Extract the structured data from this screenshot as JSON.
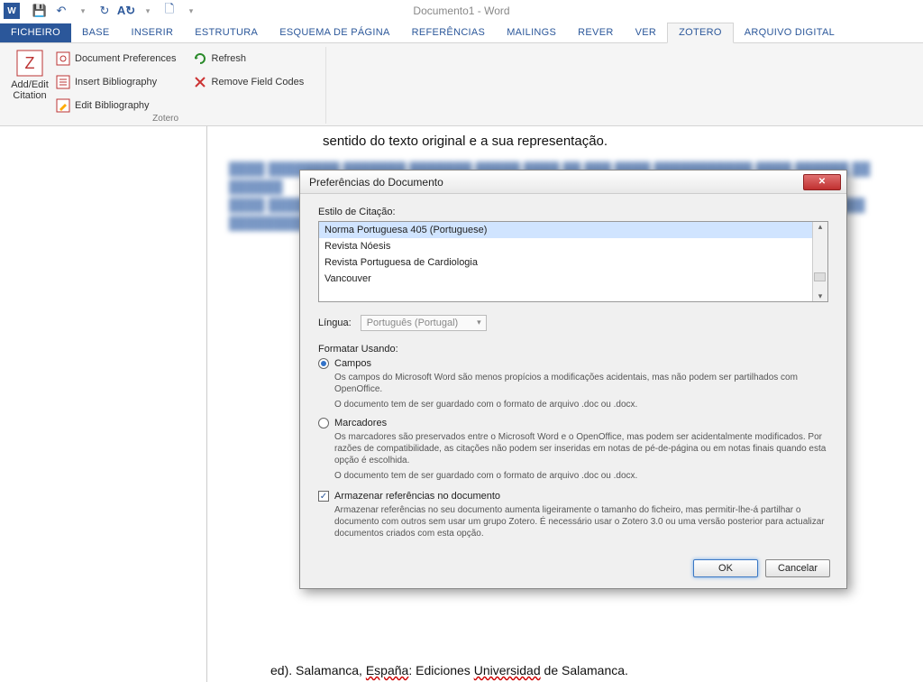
{
  "app": {
    "title": "Documento1 - Word"
  },
  "tabs": {
    "file": "FICHEIRO",
    "home": "BASE",
    "insert": "INSERIR",
    "structure": "ESTRUTURA",
    "layout": "ESQUEMA DE PÁGINA",
    "references": "REFERÊNCIAS",
    "mailings": "MAILINGS",
    "review": "REVER",
    "view": "VER",
    "zotero": "ZOTERO",
    "digital": "ARQUIVO DIGITAL"
  },
  "ribbon": {
    "addedit": "Add/Edit\nCitation",
    "docprefs": "Document Preferences",
    "insertbib": "Insert Bibliography",
    "editbib": "Edit Bibliography",
    "refresh": "Refresh",
    "removefc": "Remove Field Codes",
    "group": "Zotero"
  },
  "page": {
    "topline": "sentido do texto original e a sua representação.",
    "bottomline_a": "ed). Salamanca, ",
    "bottomline_b": "España",
    "bottomline_c": ": Ediciones ",
    "bottomline_d": "Universidad",
    "bottomline_e": " de Salamanca."
  },
  "dialog": {
    "title": "Preferências do Documento",
    "style_label": "Estilo de Citação:",
    "styles": {
      "item0": "Norma Portuguesa 405 (Portuguese)",
      "item1": "Revista Nóesis",
      "item2": "Revista Portuguesa de Cardiologia",
      "item3": "Vancouver"
    },
    "lang_label": "Língua:",
    "lang_value": "Português (Portugal)",
    "format_label": "Formatar Usando:",
    "opt_fields": "Campos",
    "opt_fields_desc1": "Os campos do Microsoft Word são menos propícios a modificações acidentais, mas não podem ser partilhados com OpenOffice.",
    "opt_fields_desc2": "O documento tem de ser guardado com o formato de arquivo .doc ou .docx.",
    "opt_book": "Marcadores",
    "opt_book_desc1": "Os marcadores são preservados entre o Microsoft Word e o OpenOffice, mas podem ser acidentalmente modificados. Por razões de compatibilidade, as citações não podem ser inseridas em notas de pé-de-página ou em notas finais quando esta opção é escolhida.",
    "opt_book_desc2": "O documento tem de ser guardado com o formato de arquivo .doc ou .docx.",
    "store_label": "Armazenar referências no documento",
    "store_desc": "Armazenar referências no seu documento aumenta ligeiramente o tamanho do ficheiro, mas permitir-lhe-á partilhar o documento com outros sem usar um grupo Zotero. É necessário usar o Zotero 3.0 ou uma versão posterior para actualizar documentos criados com esta opção.",
    "ok": "OK",
    "cancel": "Cancelar"
  }
}
